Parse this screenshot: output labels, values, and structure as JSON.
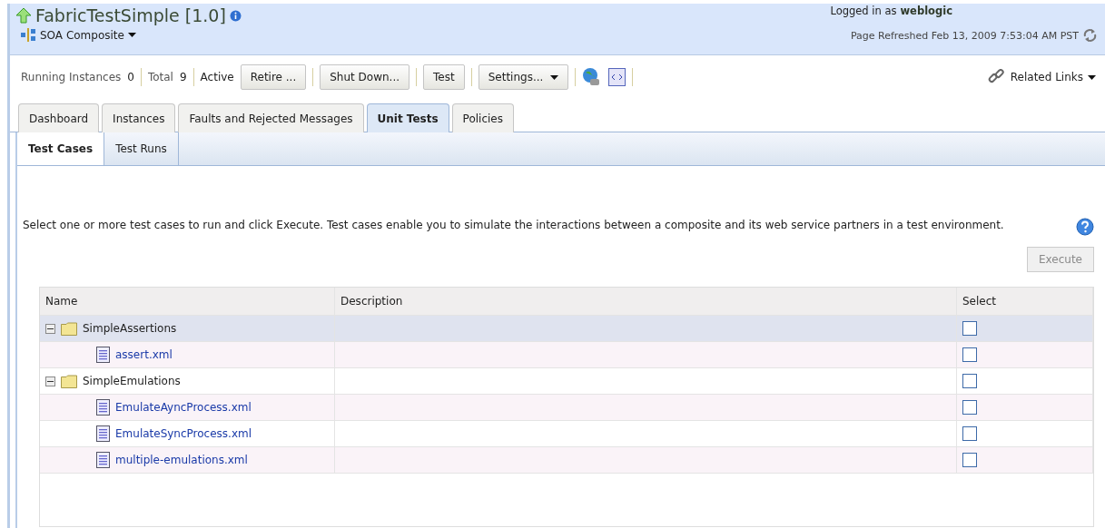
{
  "header": {
    "title": "FabricTestSimple [1.0]",
    "type_menu": "SOA Composite",
    "login_label": "Logged in as",
    "user": "weblogic",
    "refreshed": "Page Refreshed Feb 13, 2009 7:53:04 AM PST"
  },
  "toolbar": {
    "stats": [
      {
        "label": "Running Instances",
        "value": "0"
      },
      {
        "label": "Total",
        "value": "9"
      }
    ],
    "status": "Active",
    "buttons": [
      {
        "label": "Retire ...",
        "kind": "button"
      },
      {
        "label": "Shut Down...",
        "kind": "button"
      },
      {
        "label": "Test",
        "kind": "button"
      },
      {
        "label": "Settings...",
        "kind": "menu"
      }
    ],
    "related_links": "Related Links"
  },
  "tabs": [
    {
      "label": "Dashboard",
      "selected": false
    },
    {
      "label": "Instances",
      "selected": false
    },
    {
      "label": "Faults and Rejected Messages",
      "selected": false
    },
    {
      "label": "Unit Tests",
      "selected": true
    },
    {
      "label": "Policies",
      "selected": false
    }
  ],
  "subtabs": [
    {
      "label": "Test Cases",
      "selected": true
    },
    {
      "label": "Test Runs",
      "selected": false
    }
  ],
  "instructions": "Select one or more test cases to run and click Execute. Test cases enable you to simulate the interactions between a composite and its web service partners in a test environment.",
  "execute_button": {
    "label": "Execute",
    "disabled": true
  },
  "table": {
    "columns": [
      "Name",
      "Description",
      "Select"
    ],
    "rows": [
      {
        "name": "SimpleAssertions",
        "kind": "folder",
        "expanded": true,
        "selected": true,
        "checked": false,
        "children": [
          {
            "name": "assert.xml",
            "kind": "file",
            "selected": false,
            "checked": false
          }
        ]
      },
      {
        "name": "SimpleEmulations",
        "kind": "folder",
        "expanded": true,
        "selected": false,
        "checked": false,
        "children": [
          {
            "name": "EmulateAyncProcess.xml",
            "kind": "file",
            "selected": false,
            "checked": false
          },
          {
            "name": "EmulateSyncProcess.xml",
            "kind": "file",
            "selected": false,
            "checked": false
          },
          {
            "name": "multiple-emulations.xml",
            "kind": "file",
            "selected": false,
            "checked": false
          }
        ]
      }
    ]
  }
}
